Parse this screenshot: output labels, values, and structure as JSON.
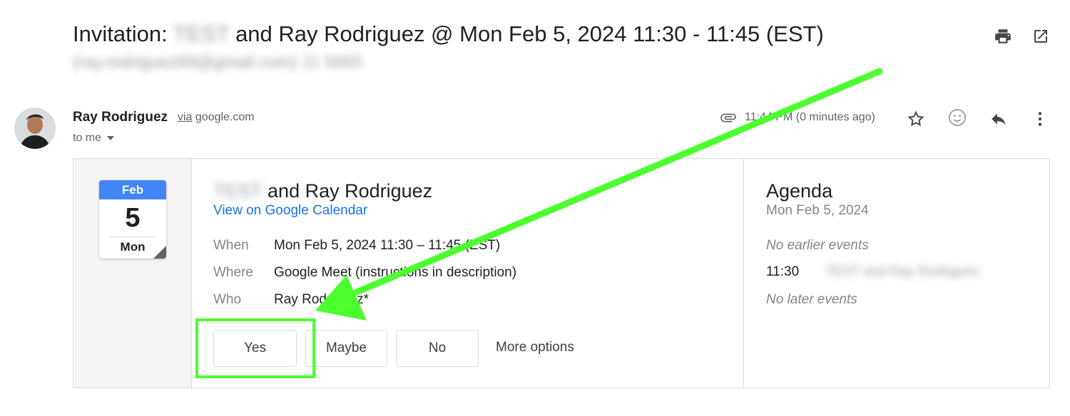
{
  "header": {
    "subject_prefix": "Invitation:",
    "subject_redacted": "TEST",
    "subject_rest": "and Ray Rodriguez @ Mon Feb 5, 2024 11:30 - 11:45 (EST)",
    "sender_email_redacted": "(ray.rodriguez89@gmail.com)  11 5665",
    "icons": [
      "print-icon",
      "open-in-new-window-icon"
    ]
  },
  "message": {
    "sender_name": "Ray Rodriguez",
    "via_label": "via",
    "via_domain": "google.com",
    "to_label": "to me",
    "timestamp": "11:44 PM (0 minutes ago)",
    "icons": [
      "attachment-icon",
      "star-icon",
      "emoji-reaction-icon",
      "reply-icon",
      "more-vert-icon"
    ]
  },
  "calendar_icon": {
    "month": "Feb",
    "day": "5",
    "weekday": "Mon"
  },
  "event": {
    "title_redacted": "TEST",
    "title_rest": "and Ray Rodriguez",
    "view_link": "View on Google Calendar",
    "details": [
      {
        "label": "When",
        "value": "Mon Feb 5, 2024 11:30 – 11:45 (EST)"
      },
      {
        "label": "Where",
        "value": "Google Meet (instructions in description)"
      },
      {
        "label": "Who",
        "value": "Ray Rodriguez*"
      }
    ]
  },
  "rsvp": {
    "yes": "Yes",
    "maybe": "Maybe",
    "no": "No",
    "more": "More options"
  },
  "agenda": {
    "title": "Agenda",
    "date": "Mon Feb 5, 2024",
    "no_earlier": "No earlier events",
    "event_time": "11:30",
    "event_title_redacted": "TEST and Ray Rodriguez",
    "no_later": "No later events"
  },
  "colors": {
    "accent_blue": "#1a73e8",
    "calendar_blue": "#4285f4",
    "annotation_green": "#4cff2e"
  }
}
